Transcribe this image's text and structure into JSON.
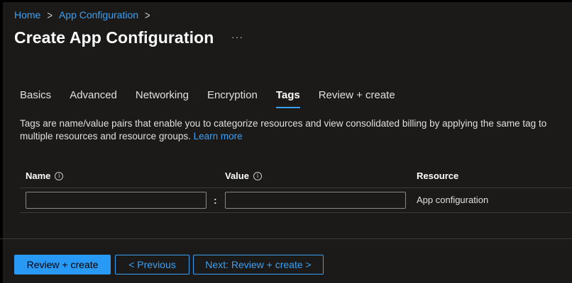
{
  "breadcrumb": {
    "items": [
      {
        "label": "Home"
      },
      {
        "label": "App Configuration"
      }
    ],
    "separator": ">"
  },
  "page": {
    "title": "Create App Configuration",
    "more_icon": "···"
  },
  "tabs": [
    {
      "label": "Basics",
      "active": false
    },
    {
      "label": "Advanced",
      "active": false
    },
    {
      "label": "Networking",
      "active": false
    },
    {
      "label": "Encryption",
      "active": false
    },
    {
      "label": "Tags",
      "active": true
    },
    {
      "label": "Review + create",
      "active": false
    }
  ],
  "description": {
    "text": "Tags are name/value pairs that enable you to categorize resources and view consolidated billing by applying the same tag to multiple resources and resource groups.",
    "link": "Learn more"
  },
  "table": {
    "headers": {
      "name": "Name",
      "value": "Value",
      "resource": "Resource"
    },
    "info_glyph": "i",
    "rows": [
      {
        "name": "",
        "separator": ":",
        "value": "",
        "resource": "App configuration"
      }
    ]
  },
  "footer": {
    "review_create": "Review + create",
    "previous": "< Previous",
    "next": "Next: Review + create >"
  },
  "colors": {
    "accent": "#3aa0f3",
    "primary_button": "#2899f5",
    "background": "#1b1a19"
  },
  "icons": [
    "chevron-right-icon",
    "more-icon",
    "info-icon"
  ]
}
